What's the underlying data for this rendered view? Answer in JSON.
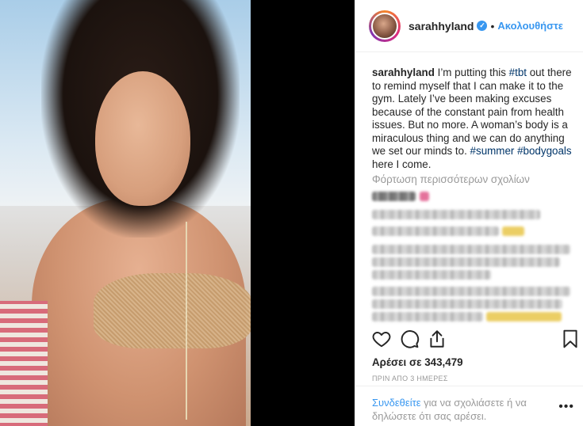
{
  "post": {
    "username": "sarahhyland",
    "follow_label": "Ακολουθήστε",
    "verified_mark": "✓",
    "separator": "•",
    "caption": {
      "user": "sarahhyland",
      "part1": " I’m putting this ",
      "tag1": "#tbt",
      "part2": " out there to remind myself that I can make it to the gym. Lately I’ve been making excuses because of the constant pain from health issues. But no more. A woman’s body is a miraculous thing and we can do anything we set our minds to. ",
      "tag2": "#summer",
      "tag3": "#bodygoals",
      "part3": "here I come."
    },
    "load_more_comments": "Φόρτωση περισσότερων σχολίων",
    "likes_text": "Αρέσει σε 343,479",
    "timestamp": "ΠΡΙΝ ΑΠΟ 3 ΗΜΕΡΕΣ",
    "footer": {
      "login_link": "Συνδεθείτε",
      "login_rest": " για να σχολιάσετε ή να δηλώσετε ότι σας αρέσει."
    },
    "more_options": "•••"
  },
  "icons": {
    "like": "heart-outline-icon",
    "comment": "comment-bubble-icon",
    "share": "share-arrow-icon",
    "save": "bookmark-icon",
    "verified": "verified-badge-icon"
  },
  "colors": {
    "accent": "#3897f0",
    "hashtag": "#003569",
    "text": "#262626",
    "muted": "#999999"
  }
}
